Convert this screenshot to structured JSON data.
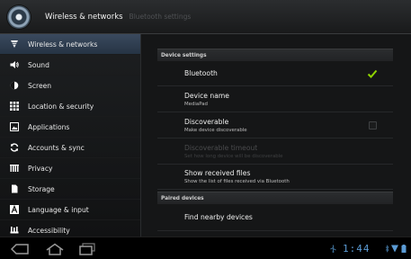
{
  "actionbar": {
    "title": "Wireless & networks",
    "subtitle": "Bluetooth settings"
  },
  "sidebar": {
    "items": [
      {
        "label": "Wireless & networks",
        "icon": "wifi-icon",
        "active": true
      },
      {
        "label": "Sound",
        "icon": "speaker-icon"
      },
      {
        "label": "Screen",
        "icon": "brightness-icon"
      },
      {
        "label": "Location & security",
        "icon": "grid-lock-icon"
      },
      {
        "label": "Applications",
        "icon": "applications-icon"
      },
      {
        "label": "Accounts & sync",
        "icon": "sync-icon"
      },
      {
        "label": "Privacy",
        "icon": "privacy-icon"
      },
      {
        "label": "Storage",
        "icon": "storage-icon"
      },
      {
        "label": "Language & input",
        "icon": "language-icon"
      },
      {
        "label": "Accessibility",
        "icon": "accessibility-icon"
      }
    ]
  },
  "main": {
    "device_settings_header": "Device settings",
    "bluetooth": {
      "title": "Bluetooth",
      "checked": true
    },
    "device_name": {
      "title": "Device name",
      "summary": "MediaPad"
    },
    "discoverable": {
      "title": "Discoverable",
      "summary": "Make device discoverable",
      "checked": false
    },
    "discoverable_timeout": {
      "title": "Discoverable timeout",
      "summary": "Set how long device will be discoverable"
    },
    "show_received": {
      "title": "Show received files",
      "summary": "Show the list of files received via Bluetooth"
    },
    "paired_devices_header": "Paired devices",
    "find_nearby": {
      "title": "Find nearby devices"
    }
  },
  "system_bar": {
    "clock": "1:44",
    "accent_color": "#5b9bd5"
  }
}
